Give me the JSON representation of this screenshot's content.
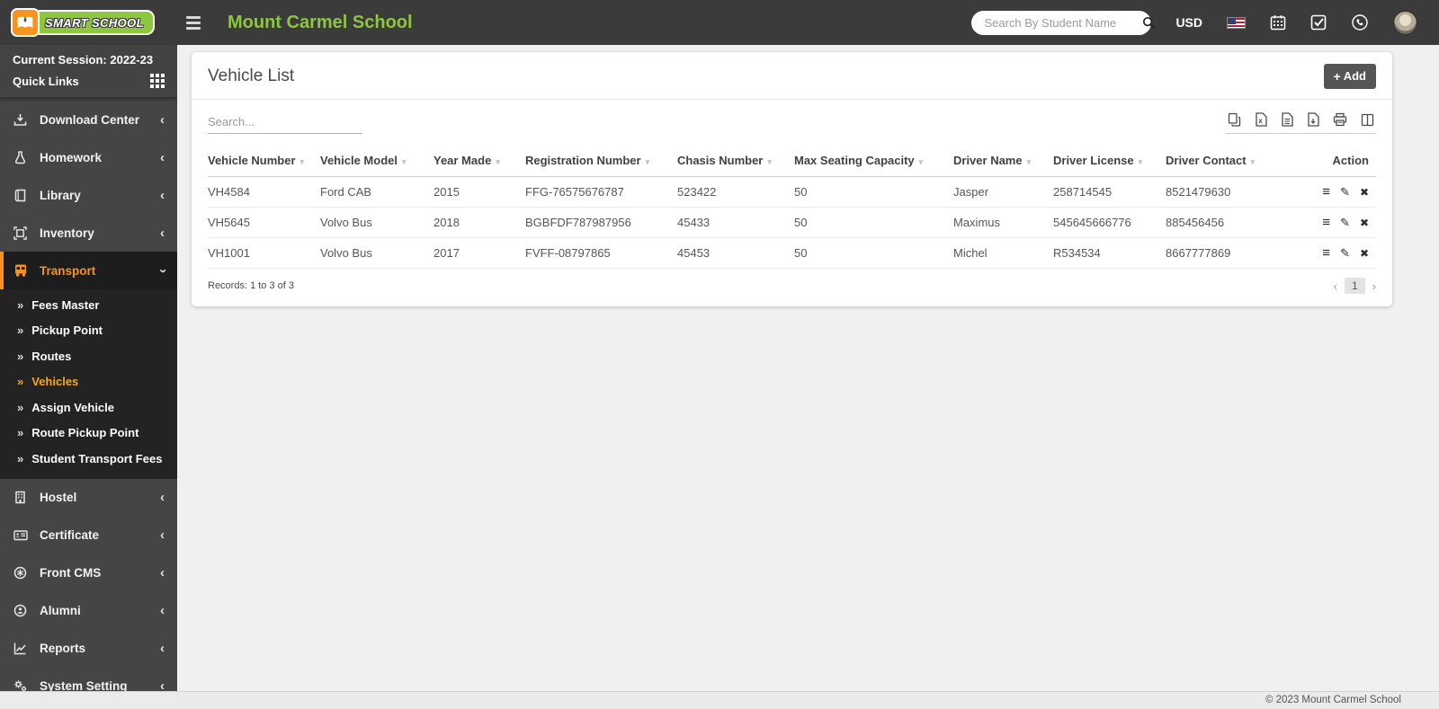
{
  "header": {
    "logo_text": "SMART SCHOOL",
    "school_name": "Mount Carmel School",
    "search_placeholder": "Search By Student Name",
    "currency_label": "USD"
  },
  "sidebar": {
    "session_label": "Current Session: 2022-23",
    "quick_links_label": "Quick Links",
    "items": [
      {
        "label": "Download Center"
      },
      {
        "label": "Homework"
      },
      {
        "label": "Library"
      },
      {
        "label": "Inventory"
      },
      {
        "label": "Transport",
        "active": true
      },
      {
        "label": "Hostel"
      },
      {
        "label": "Certificate"
      },
      {
        "label": "Front CMS"
      },
      {
        "label": "Alumni"
      },
      {
        "label": "Reports"
      },
      {
        "label": "System Setting"
      }
    ],
    "transport_submenu": [
      {
        "label": "Fees Master"
      },
      {
        "label": "Pickup Point"
      },
      {
        "label": "Routes"
      },
      {
        "label": "Vehicles",
        "active": true
      },
      {
        "label": "Assign Vehicle"
      },
      {
        "label": "Route Pickup Point"
      },
      {
        "label": "Student Transport Fees"
      }
    ]
  },
  "main": {
    "page_title": "Vehicle List",
    "add_button_label": "Add",
    "table_search_placeholder": "Search...",
    "table": {
      "headers": [
        "Vehicle Number",
        "Vehicle Model",
        "Year Made",
        "Registration Number",
        "Chasis Number",
        "Max Seating Capacity",
        "Driver Name",
        "Driver License",
        "Driver Contact",
        "Action"
      ],
      "rows": [
        [
          "VH4584",
          "Ford CAB",
          "2015",
          "FFG-76575676787",
          "523422",
          "50",
          "Jasper",
          "258714545",
          "8521479630"
        ],
        [
          "VH5645",
          "Volvo Bus",
          "2018",
          "BGBFDF787987956",
          "45433",
          "50",
          "Maximus",
          "545645666776",
          "885456456"
        ],
        [
          "VH1001",
          "Volvo Bus",
          "2017",
          "FVFF-08797865",
          "45453",
          "50",
          "Michel",
          "R534534",
          "8667777869"
        ]
      ]
    },
    "records_text": "Records: 1 to 3 of 3",
    "pagination": {
      "prev": "‹",
      "current_page": "1",
      "next": "›"
    }
  },
  "footer": {
    "copyright": "© 2023 Mount Carmel School"
  },
  "icons": {
    "sort_caret": "▾",
    "submenu_arrow": "»",
    "collapse_chevron": "‹",
    "action_menu": "≡",
    "action_edit": "✎",
    "action_delete": "✖",
    "add_plus": "+"
  },
  "colors": {
    "accent_green": "#8dc63f",
    "accent_orange": "#f7941e",
    "header_bg": "#3b3b3b",
    "sidebar_bg": "#454545",
    "active_item_bg": "#1d1d1d",
    "page_bg": "#f0f0f1",
    "footer_bg": "#ebebeb"
  }
}
